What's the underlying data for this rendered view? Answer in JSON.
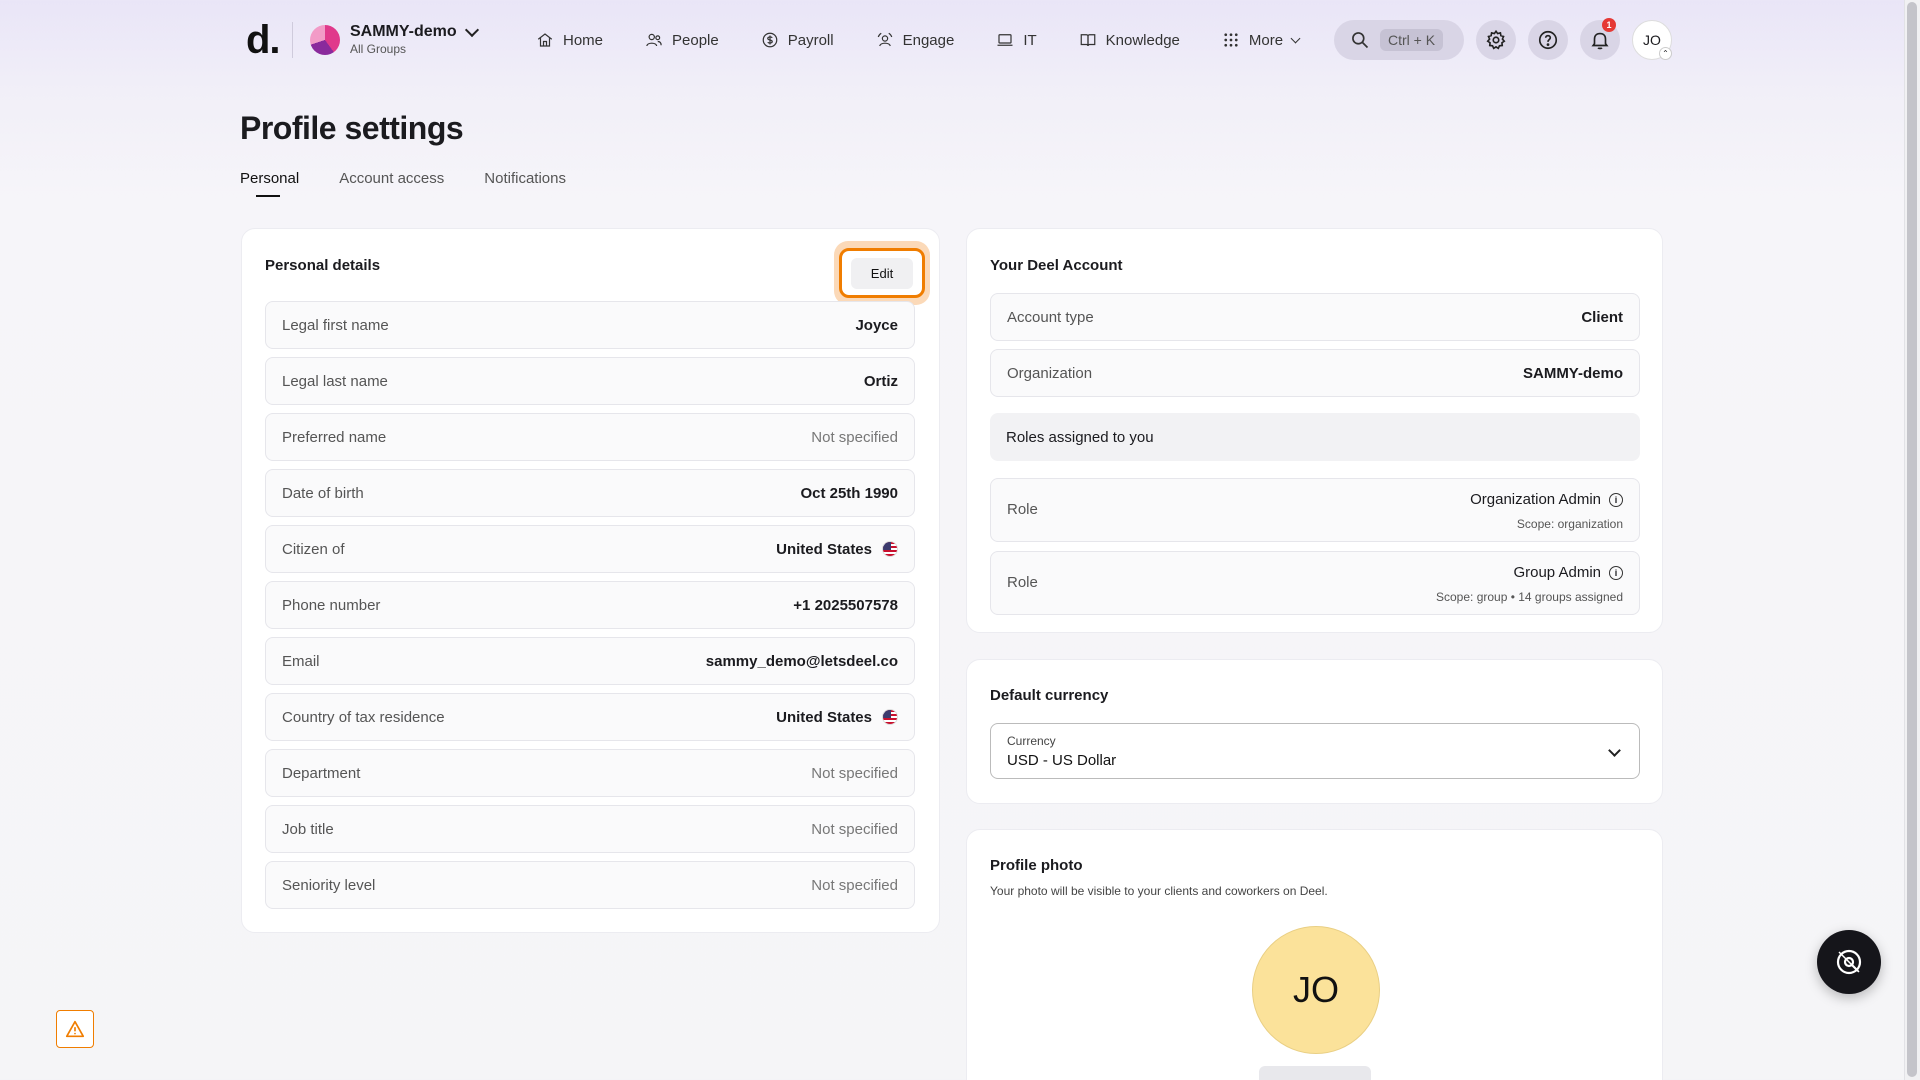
{
  "brand": {
    "logo": "d."
  },
  "org": {
    "name": "SAMMY-demo",
    "sub": "All Groups"
  },
  "nav": [
    {
      "label": "Home",
      "icon": "home-icon"
    },
    {
      "label": "People",
      "icon": "people-icon"
    },
    {
      "label": "Payroll",
      "icon": "payroll-icon"
    },
    {
      "label": "Engage",
      "icon": "engage-icon"
    },
    {
      "label": "IT",
      "icon": "laptop-icon"
    },
    {
      "label": "Knowledge",
      "icon": "book-icon"
    },
    {
      "label": "More",
      "icon": "grid-icon"
    }
  ],
  "search": {
    "shortcut": "Ctrl + K"
  },
  "notifications": {
    "count": "1"
  },
  "user": {
    "initials": "JO"
  },
  "page": {
    "title": "Profile settings"
  },
  "tabs": [
    {
      "label": "Personal",
      "active": true
    },
    {
      "label": "Account access",
      "active": false
    },
    {
      "label": "Notifications",
      "active": false
    }
  ],
  "personal": {
    "title": "Personal details",
    "edit_label": "Edit",
    "fields": [
      {
        "label": "Legal first name",
        "value": "Joyce"
      },
      {
        "label": "Legal last name",
        "value": "Ortiz"
      },
      {
        "label": "Preferred name",
        "value": "Not specified"
      },
      {
        "label": "Date of birth",
        "value": "Oct 25th 1990"
      },
      {
        "label": "Citizen of",
        "value": "United States"
      },
      {
        "label": "Phone number",
        "value": "+1 2025507578"
      },
      {
        "label": "Email",
        "value": "sammy_demo@letsdeel.co"
      },
      {
        "label": "Country of tax residence",
        "value": "United States"
      },
      {
        "label": "Department",
        "value": "Not specified"
      },
      {
        "label": "Job title",
        "value": "Not specified"
      },
      {
        "label": "Seniority level",
        "value": "Not specified"
      }
    ]
  },
  "account": {
    "title": "Your Deel Account",
    "type_label": "Account type",
    "type_value": "Client",
    "org_label": "Organization",
    "org_value": "SAMMY-demo",
    "roles_header": "Roles assigned to you",
    "roles": [
      {
        "label": "Role",
        "name": "Organization Admin",
        "scope": "Scope: organization"
      },
      {
        "label": "Role",
        "name": "Group Admin",
        "scope": "Scope: group • 14 groups assigned"
      }
    ]
  },
  "currency": {
    "title": "Default currency",
    "field_label": "Currency",
    "value": "USD - US Dollar"
  },
  "photo": {
    "title": "Profile photo",
    "description": "Your photo will be visible to your clients and coworkers on Deel.",
    "initials": "JO"
  },
  "colors": {
    "accent": "#f07d00",
    "avatar": "#fbe29a",
    "badge": "#e53935"
  }
}
